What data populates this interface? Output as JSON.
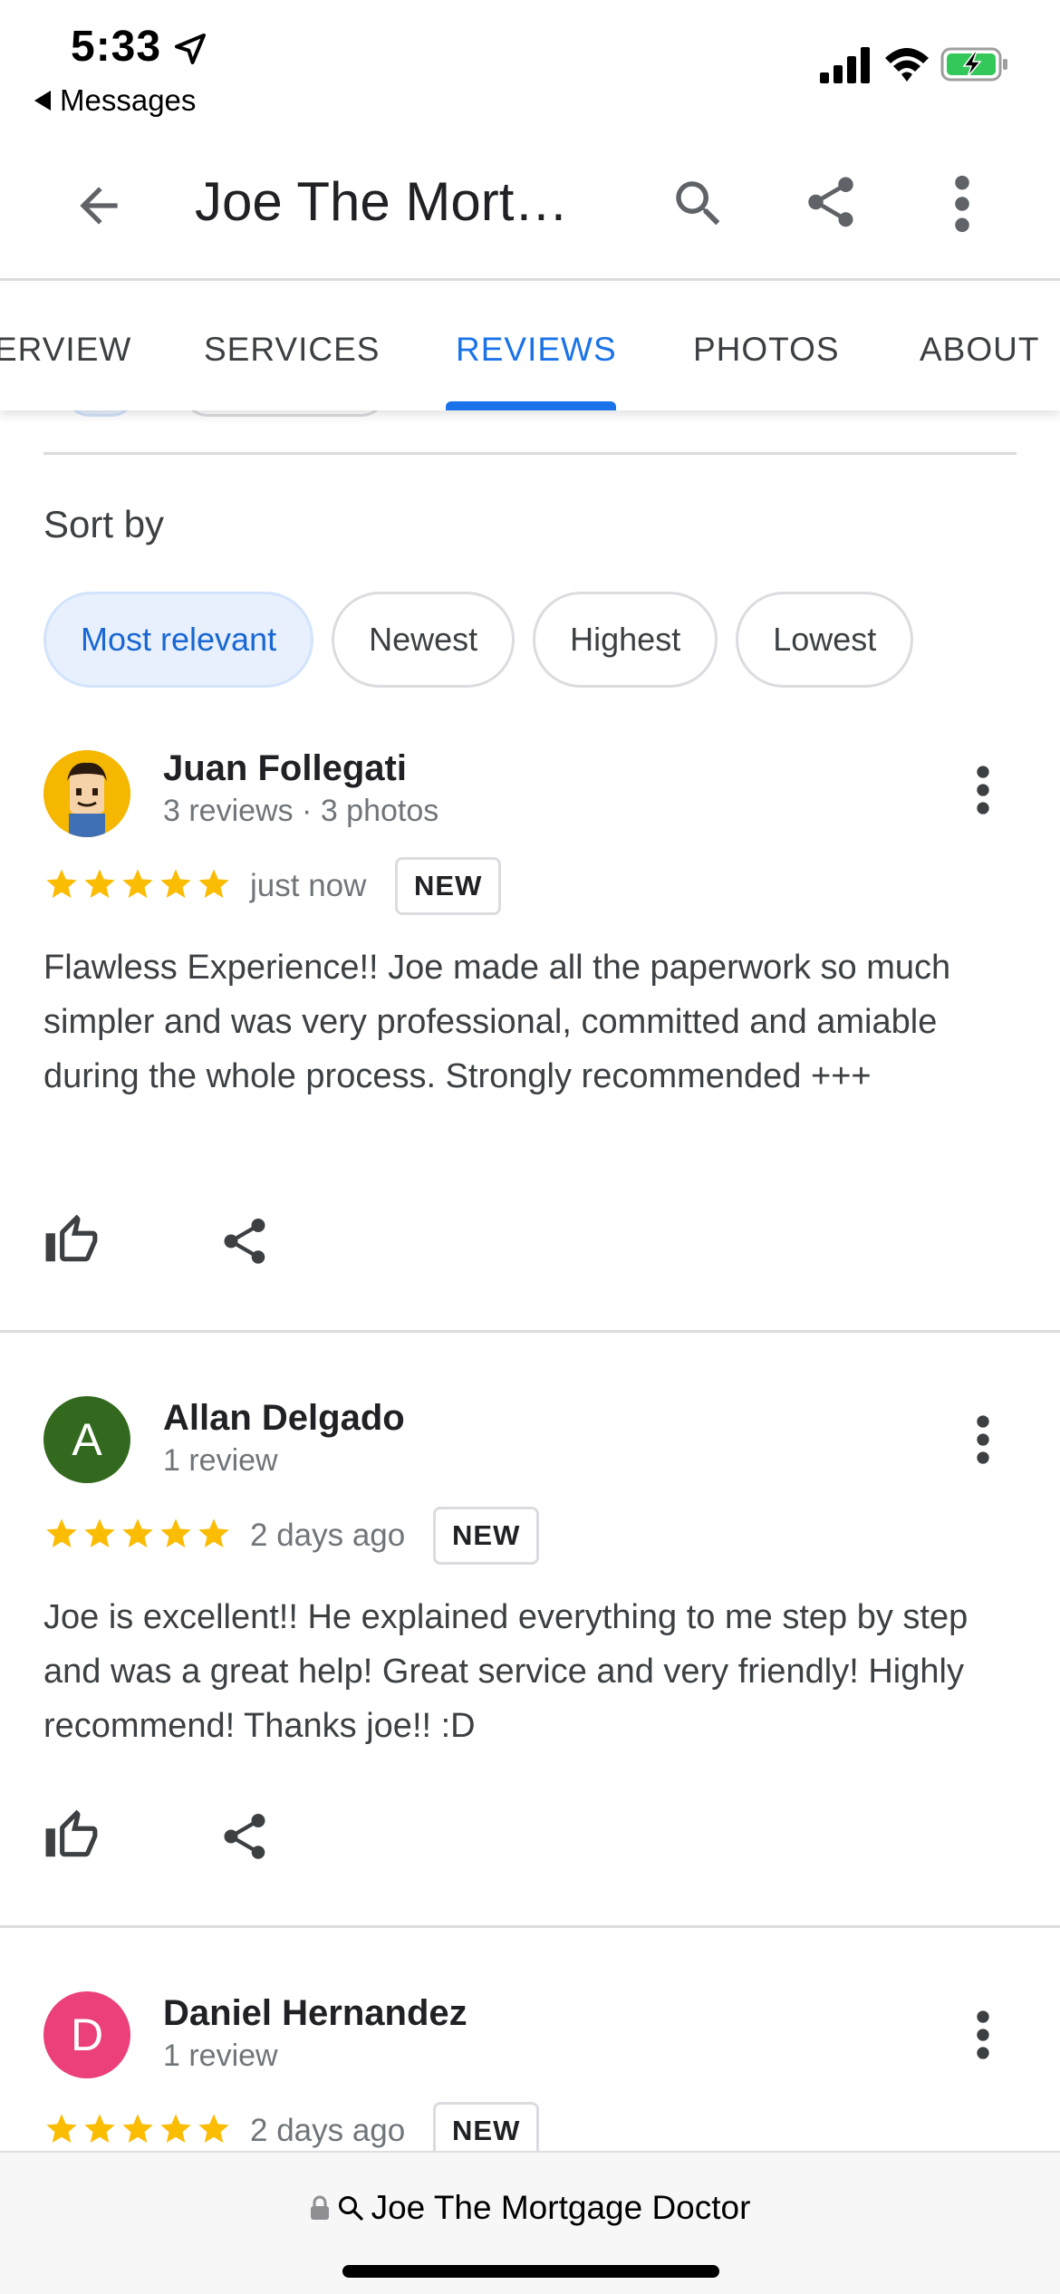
{
  "status_bar": {
    "time": "5:33",
    "back_app": "Messages"
  },
  "app_bar": {
    "title": "Joe The Mort…"
  },
  "tabs": [
    {
      "label": "ERVIEW"
    },
    {
      "label": "SERVICES"
    },
    {
      "label": "REVIEWS",
      "active": true
    },
    {
      "label": "PHOTOS"
    },
    {
      "label": "ABOUT"
    }
  ],
  "sort": {
    "label": "Sort by",
    "options": [
      {
        "label": "Most relevant",
        "selected": true
      },
      {
        "label": "Newest"
      },
      {
        "label": "Highest"
      },
      {
        "label": "Lowest"
      }
    ]
  },
  "reviews": [
    {
      "name": "Juan Follegati",
      "meta": "3 reviews · 3 photos",
      "rating": 5,
      "time": "just now",
      "badge": "NEW",
      "text": "Flawless Experience!! Joe made all the paperwork so much simpler and was very professional, committed and amiable during the whole process. Strongly recommended +++",
      "avatar_type": "cartoon-image"
    },
    {
      "name": "Allan Delgado",
      "meta": "1 review",
      "rating": 5,
      "time": "2 days ago",
      "badge": "NEW",
      "text": "Joe is excellent!! He explained everything to me step by step and was a great help! Great service and very friendly! Highly recommend! Thanks joe!! :D",
      "avatar_letter": "A",
      "avatar_color": "#33691e"
    },
    {
      "name": "Daniel Hernandez",
      "meta": "1 review",
      "rating": 5,
      "time": "2 days ago",
      "badge": "NEW",
      "avatar_letter": "D",
      "avatar_color": "#ec407a"
    }
  ],
  "bottom_bar": {
    "url": "Joe The Mortgage Doctor"
  },
  "colors": {
    "accent": "#1a73e8",
    "star": "#fbbc04",
    "chip_selected_bg": "#e8f0fe"
  }
}
